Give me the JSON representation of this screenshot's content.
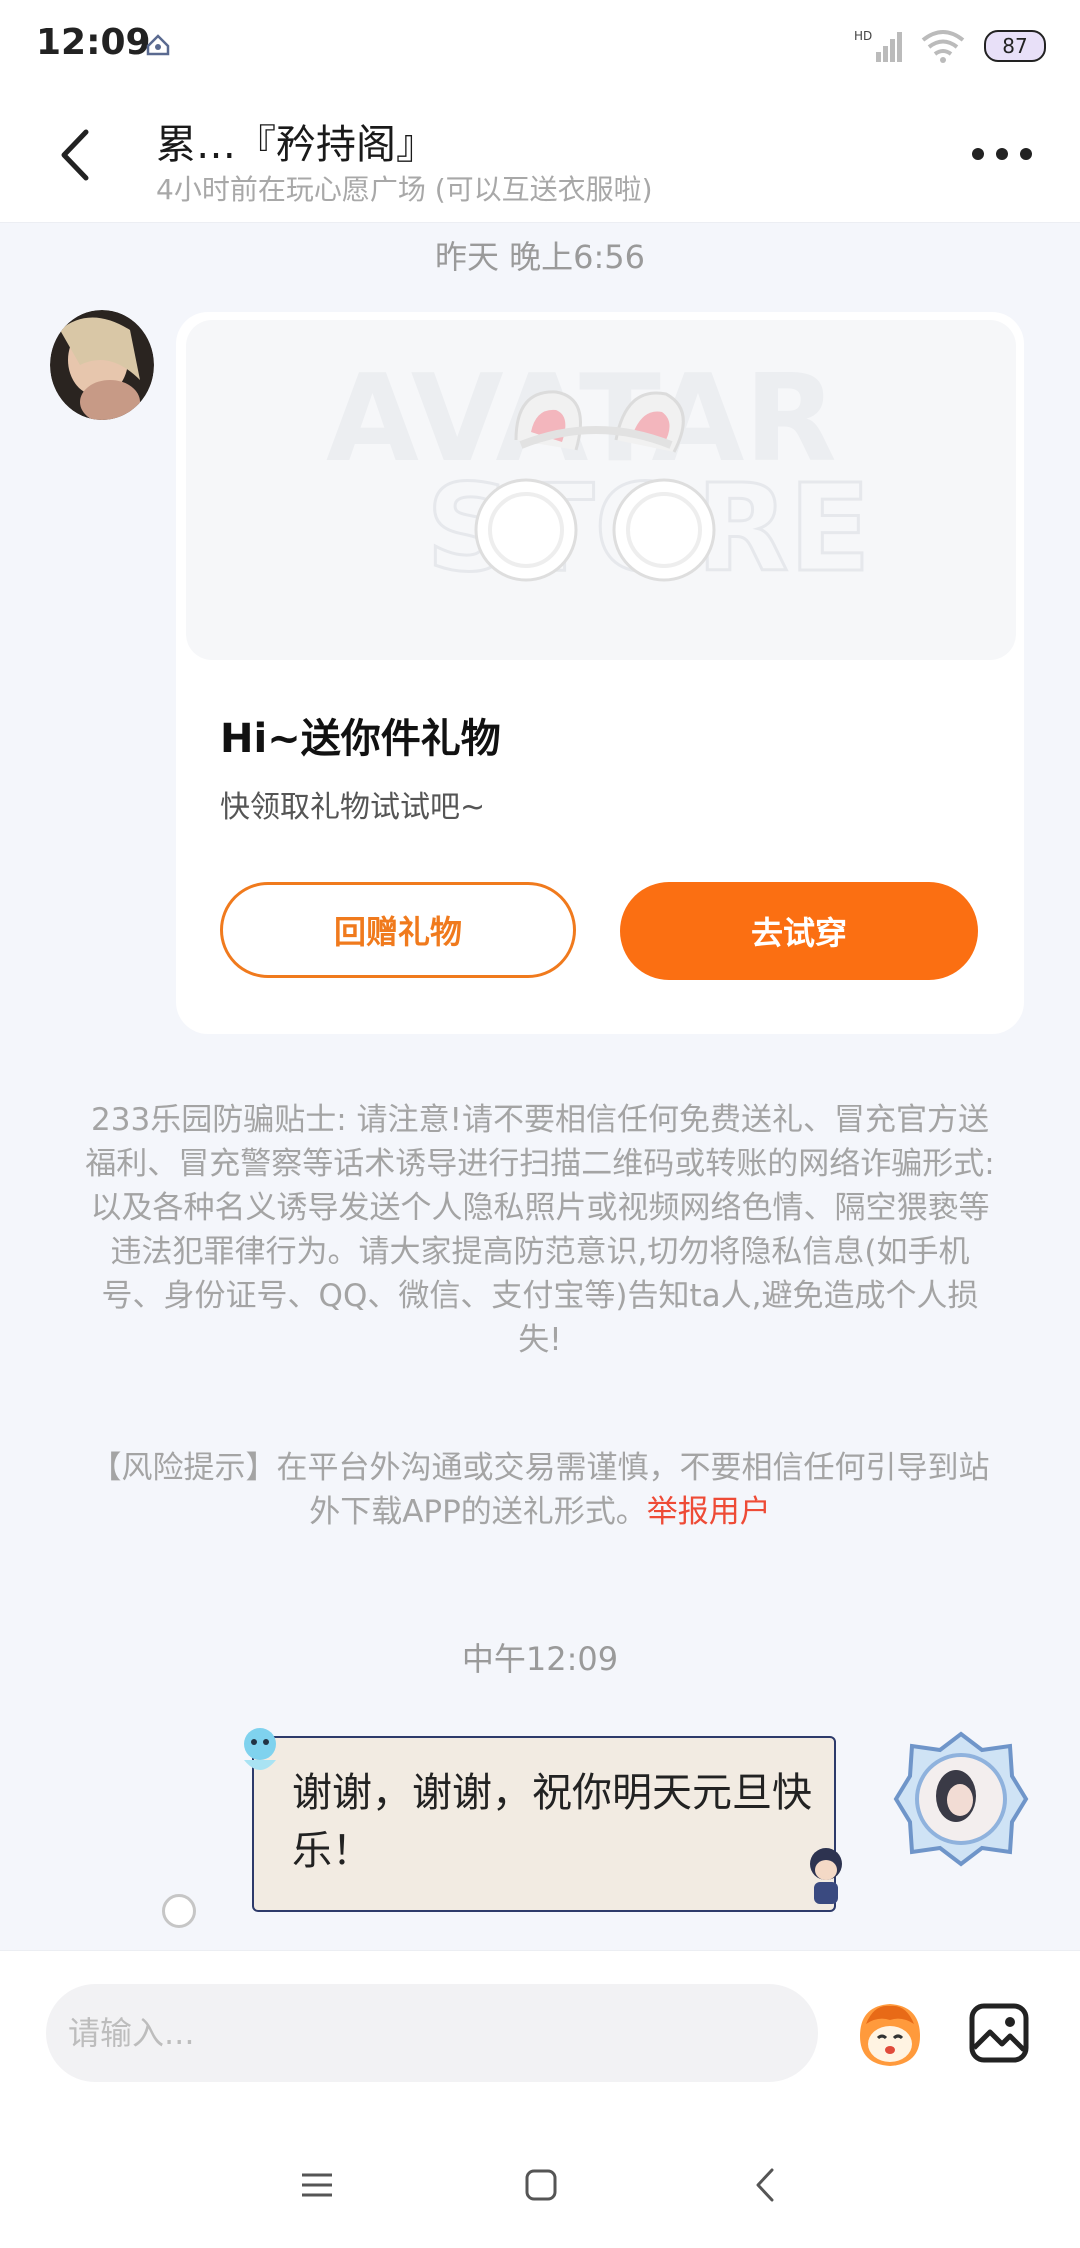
{
  "status_bar": {
    "time": "12:09",
    "network": "HD",
    "battery": "87"
  },
  "header": {
    "title": "累…『矜持阁』",
    "subtitle": "4小时前在玩心愿广场 (可以互送衣服啦)"
  },
  "messages": {
    "timestamp_1": "昨天 晚上6:56",
    "gift_card": {
      "watermark_line1": "AVATAR",
      "watermark_line2": "STORE",
      "title": "Hi~送你件礼物",
      "subtitle": "快领取礼物试试吧~",
      "return_gift_label": "回赠礼物",
      "try_on_label": "去试穿"
    },
    "safety_notice": "233乐园防骗贴士: 请注意!请不要相信任何免费送礼、冒充官方送福利、冒充警察等话术诱导进行扫描二维码或转账的网络诈骗形式:以及各种名义诱导发送个人隐私照片或视频网络色情、隔空猥亵等违法犯罪律行为。请大家提高防范意识,切勿将隐私信息(如手机号、身份证号、QQ、微信、支付宝等)告知ta人,避免造成个人损失!",
    "risk_notice": "【风险提示】在平台外沟通或交易需谨慎，不要相信任何引导到站外下载APP的送礼形式。",
    "report_link": "举报用户",
    "timestamp_2": "中午12:09",
    "outgoing_text": "谢谢，谢谢，祝你明天元旦快乐！"
  },
  "input": {
    "placeholder": "请输入..."
  },
  "colors": {
    "accent_orange": "#fb6f12",
    "report_red": "#ee4b36",
    "background": "#f4f6fb"
  },
  "icons": {
    "back": "back-arrow-icon",
    "more": "more-icon",
    "emoji": "emoji-icon",
    "image": "image-icon",
    "nav_menu": "menu-icon",
    "nav_home": "home-icon",
    "nav_back": "nav-back-icon"
  }
}
